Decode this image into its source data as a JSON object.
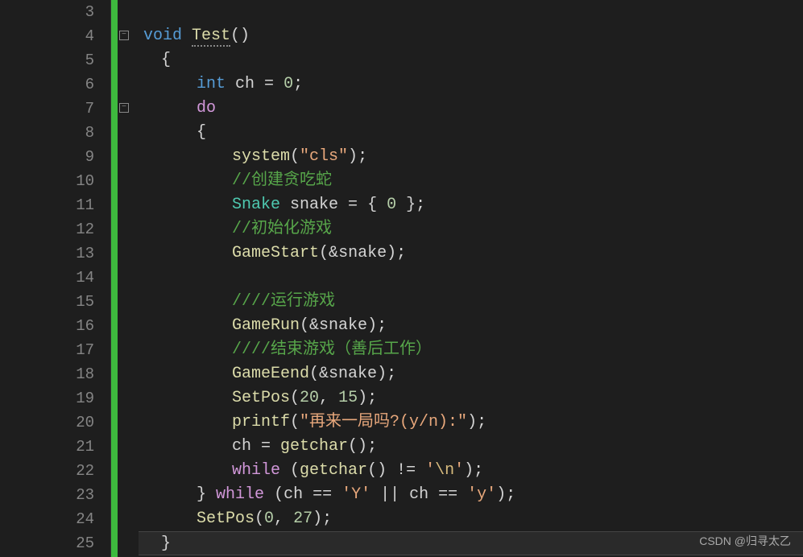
{
  "gutter": {
    "line_numbers": [
      "3",
      "4",
      "5",
      "6",
      "7",
      "8",
      "9",
      "10",
      "11",
      "12",
      "13",
      "14",
      "15",
      "16",
      "17",
      "18",
      "19",
      "20",
      "21",
      "22",
      "23",
      "24",
      "25"
    ]
  },
  "fold": {
    "minus": "−"
  },
  "code": {
    "l4": {
      "void": "void",
      "space1": " ",
      "func": "Test",
      "paren": "()"
    },
    "l5": {
      "brace": "{"
    },
    "l6": {
      "int": "int",
      "space": " ",
      "var": "ch",
      "eq": " = ",
      "zero": "0",
      "semi": ";"
    },
    "l7": {
      "do": "do"
    },
    "l8": {
      "brace": "{"
    },
    "l9": {
      "func": "system",
      "open": "(",
      "str": "\"cls\"",
      "close": ")",
      "semi": ";"
    },
    "l10": {
      "comment": "//创建贪吃蛇"
    },
    "l11": {
      "type": "Snake",
      "space": " ",
      "var": "snake",
      "eq": " = ",
      "open": "{ ",
      "zero": "0",
      "close": " }",
      "semi": ";"
    },
    "l12": {
      "comment": "//初始化游戏"
    },
    "l13": {
      "func": "GameStart",
      "open": "(",
      "amp": "&",
      "var": "snake",
      "close": ")",
      "semi": ";"
    },
    "l15": {
      "comment": "////运行游戏"
    },
    "l16": {
      "func": "GameRun",
      "open": "(",
      "amp": "&",
      "var": "snake",
      "close": ")",
      "semi": ";"
    },
    "l17": {
      "comment": "////结束游戏（善后工作）"
    },
    "l18": {
      "func": "GameEend",
      "open": "(",
      "amp": "&",
      "var": "snake",
      "close": ")",
      "semi": ";"
    },
    "l19": {
      "func": "SetPos",
      "open": "(",
      "n1": "20",
      "comma": ", ",
      "n2": "15",
      "close": ")",
      "semi": ";"
    },
    "l20": {
      "func": "printf",
      "open": "(",
      "str": "\"再来一局吗?(y/n):\"",
      "close": ")",
      "semi": ";"
    },
    "l21": {
      "var": "ch",
      "eq": " = ",
      "func": "getchar",
      "paren": "()",
      "semi": ";"
    },
    "l22": {
      "while": "while",
      "space": " ",
      "open": "(",
      "func": "getchar",
      "paren": "()",
      "neq": " != ",
      "q1": "'",
      "esc": "\\n",
      "q2": "'",
      "close": ")",
      "semi": ";"
    },
    "l23": {
      "brace": "}",
      "space1": " ",
      "while": "while",
      "space2": " ",
      "open": "(",
      "var1": "ch",
      "eq1": " == ",
      "lit1": "'Y'",
      "or": " || ",
      "var2": "ch",
      "eq2": " == ",
      "lit2": "'y'",
      "close": ")",
      "semi": ";"
    },
    "l24": {
      "func": "SetPos",
      "open": "(",
      "n1": "0",
      "comma": ", ",
      "n2": "27",
      "close": ")",
      "semi": ";"
    },
    "l25": {
      "brace": "}"
    }
  },
  "watermark": "CSDN @归寻太乙"
}
